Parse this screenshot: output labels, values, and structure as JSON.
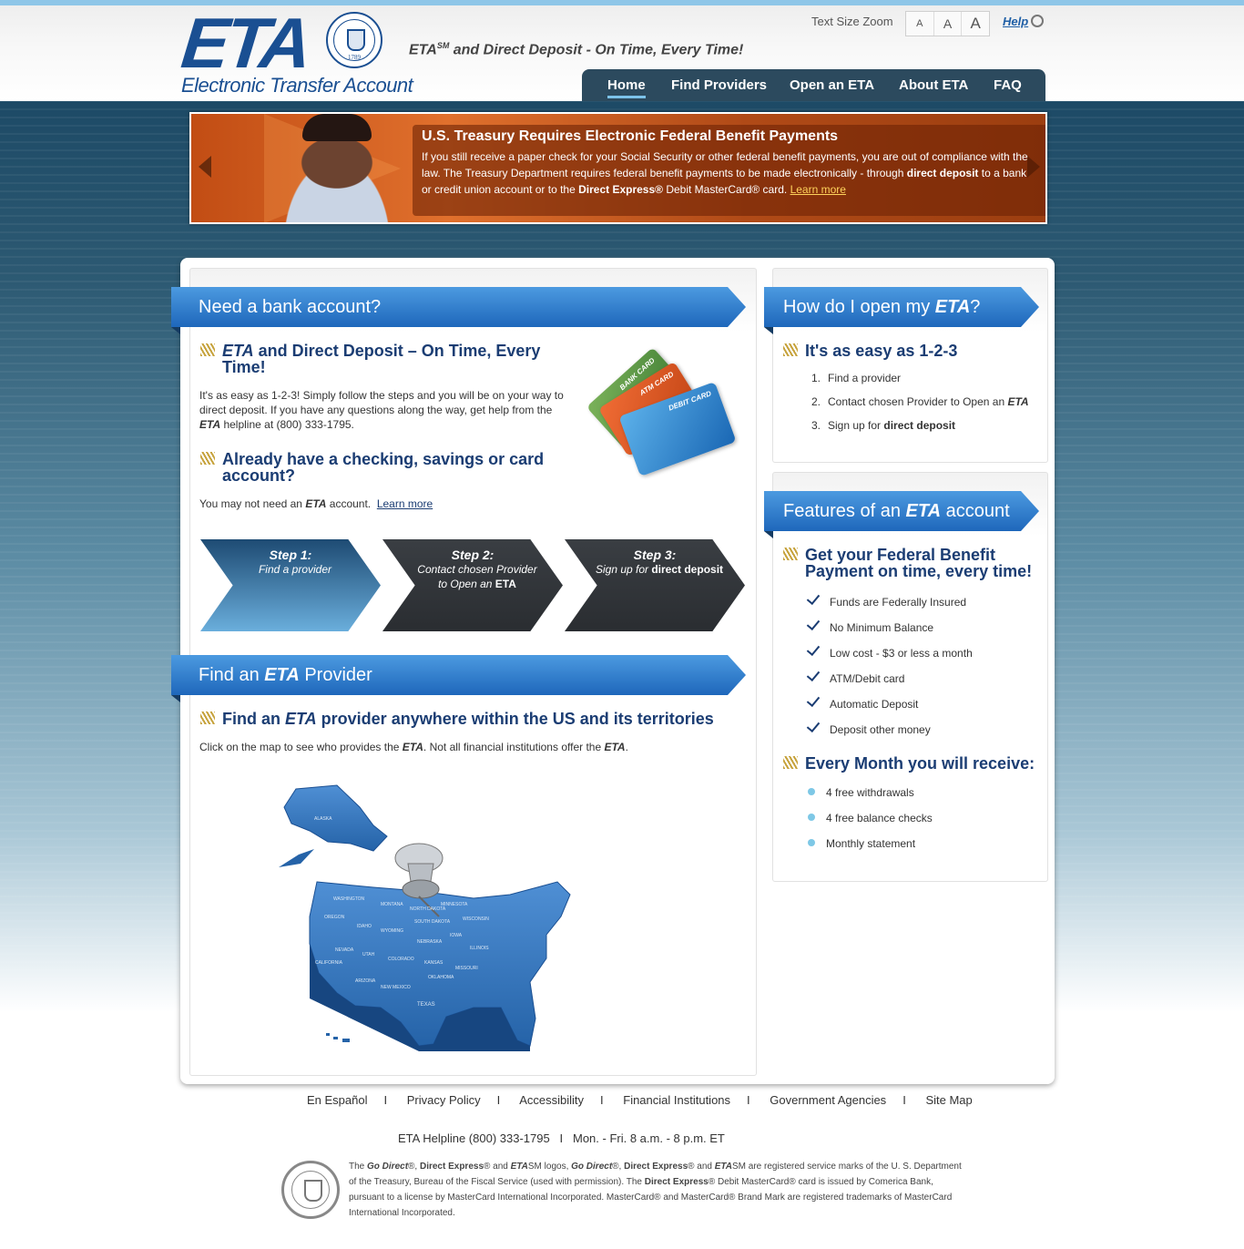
{
  "header": {
    "logo_text": "ETA",
    "logo_subtitle": "Electronic Transfer Account",
    "seal_year": "1789",
    "tagline_pre": "ETA",
    "tagline_sup": "SM",
    "tagline_post": " and Direct Deposit - On Time, Every Time!",
    "text_size_label": "Text Size Zoom",
    "text_size_options": [
      "A",
      "A",
      "A"
    ],
    "help_label": "Help"
  },
  "nav": {
    "items": [
      "Home",
      "Find Providers",
      "Open an ETA",
      "About ETA",
      "FAQ"
    ],
    "active": "Home"
  },
  "banner": {
    "title": "U.S. Treasury Requires Electronic Federal Benefit Payments",
    "body_1": "If you still receive a paper check for your Social Security or other federal benefit payments, you are out of compliance with the law. The Treasury Department requires federal benefit payments to be made electronically - through ",
    "body_bold_1": "direct deposit",
    "body_2": " to a bank or credit union account or to the ",
    "body_bold_2": "Direct Express®",
    "body_3": " Debit MasterCard® card. ",
    "learn_more": "Learn more"
  },
  "left": {
    "ribbon_title": "Need a bank account?",
    "heading1_em": "ETA",
    "heading1_rest": " and Direct Deposit – On Time, Every",
    "heading1_line2": "Time!",
    "para1_a": "It's as easy as 1-2-3! Simply follow the steps and you will be on your way to",
    "para1_b": "direct deposit. If you have any questions along the way, get help from the",
    "para1_c_em": "ETA",
    "para1_c": " helpline at (800) 333-1795.",
    "heading2_line1": "Already have a checking, savings or card",
    "heading2_line2": "account?",
    "para2_a": "You may not need an ",
    "para2_em": "ETA",
    "para2_b": " account.",
    "para2_link": "Learn more",
    "cards": [
      "BANK CARD",
      "ATM CARD",
      "DEBIT CARD"
    ],
    "steps": [
      {
        "title": "Step 1:",
        "line1": "Find a provider",
        "line2": "",
        "bold": ""
      },
      {
        "title": "Step 2:",
        "line1": "Contact chosen Provider",
        "line2": "to Open an ",
        "bold": "ETA"
      },
      {
        "title": "Step 3:",
        "line1": "Sign up for ",
        "line2": "",
        "bold": "direct deposit"
      }
    ],
    "find_ribbon_pre": "Find an ",
    "find_ribbon_em": "ETA",
    "find_ribbon_post": " Provider",
    "find_heading_pre": "Find an ",
    "find_heading_em": "ETA",
    "find_heading_post": " provider anywhere within the US and its territories",
    "find_text_a": "Click on the map to see who provides the ",
    "find_text_em1": "ETA",
    "find_text_b": ". Not all financial institutions offer the ",
    "find_text_em2": "ETA",
    "find_text_c": ".",
    "map_labels": [
      "ALASKA",
      "WASHINGTON",
      "MONTANA",
      "NORTH DAKOTA",
      "OREGON",
      "IDAHO",
      "WYOMING",
      "SOUTH DAKOTA",
      "NEVADA",
      "UTAH",
      "COLORADO",
      "NEBRASKA",
      "KANSAS",
      "CALIFORNIA",
      "ARIZONA",
      "NEW MEXICO",
      "OKLAHOMA",
      "TEXAS",
      "IOWA",
      "MISSOURI",
      "ILLINOIS",
      "MINNESOTA",
      "WISCONSIN"
    ]
  },
  "right1": {
    "ribbon_pre": "How do I open my ",
    "ribbon_em": "ETA",
    "ribbon_post": "?",
    "heading": "It's as easy as 1-2-3",
    "items": [
      {
        "n": "1.",
        "text": "Find a provider",
        "em": ""
      },
      {
        "n": "2.",
        "text": "Contact chosen Provider to Open an ",
        "em": "ETA"
      },
      {
        "n": "3.",
        "text": "Sign up for ",
        "em": "direct deposit"
      }
    ]
  },
  "right2": {
    "ribbon_pre": "Features of an ",
    "ribbon_em": "ETA",
    "ribbon_post": " account",
    "heading_l1": "Get your Federal Benefit",
    "heading_l2": "Payment on time, every time!",
    "features": [
      "Funds are Federally Insured",
      "No Minimum Balance",
      "Low cost - $3 or less a month",
      "ATM/Debit card",
      "Automatic Deposit",
      "Deposit other money"
    ],
    "monthly_heading": "Every Month you will receive:",
    "monthly": [
      "4 free withdrawals",
      "4 free balance checks",
      "Monthly statement"
    ]
  },
  "footer": {
    "links": [
      "En Español",
      "Privacy Policy",
      "Accessibility",
      "Financial Institutions",
      "Government Agencies",
      "Site Map"
    ],
    "separator": "I",
    "helpline": "ETA Helpline (800) 333-1795",
    "hours": "Mon. - Fri. 8 a.m. - 8 p.m. ET",
    "legal_1": "The ",
    "legal_b1": "Go Direct",
    "legal_2": "®, ",
    "legal_b2": "Direct Express",
    "legal_3": "® and ",
    "legal_b3": "ETA",
    "legal_4": "SM logos, ",
    "legal_b4": "Go Direct",
    "legal_5": "®, ",
    "legal_b5": "Direct Express",
    "legal_6": "® and ",
    "legal_b6": "ETA",
    "legal_7": "SM are registered service marks of the U. S. Department of the Treasury, Bureau of the Fiscal Service (used with permission). The ",
    "legal_b7": "Direct Express",
    "legal_8": "® Debit MasterCard® card is issued by Comerica Bank, pursuant to a license by MasterCard International Incorporated. MasterCard® and MasterCard® Brand Mark are registered trademarks of MasterCard International Incorporated."
  },
  "colors": {
    "brand_blue": "#1a4f92",
    "ribbon_blue": "#1e67bb",
    "nav_bg": "#2c4a5e",
    "banner_orange": "#c24d14",
    "step1_blue": "#2f6fa8",
    "step_dark": "#2f3337"
  }
}
